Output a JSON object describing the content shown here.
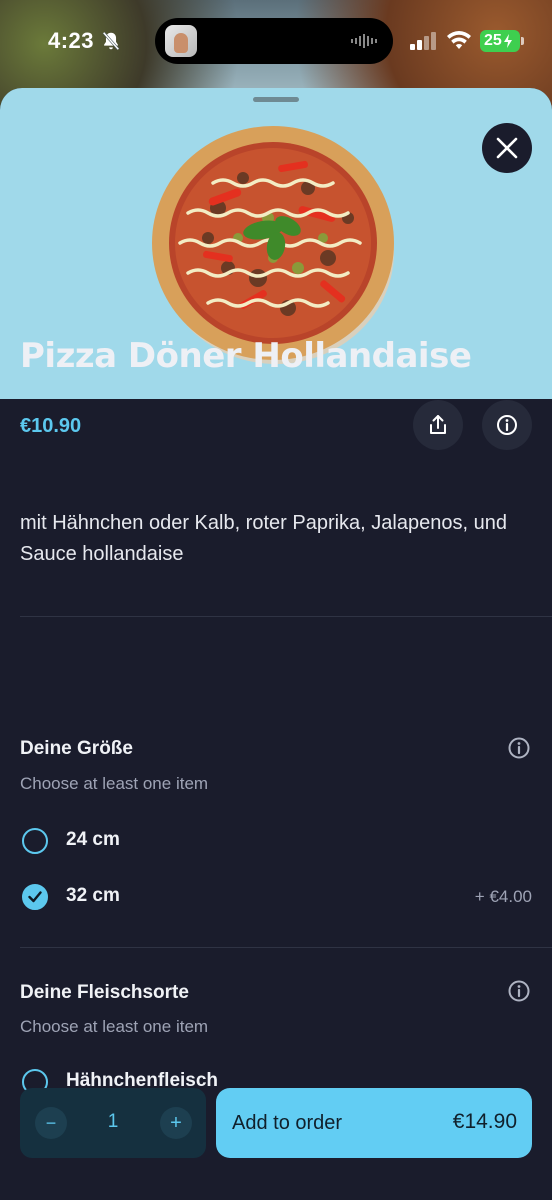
{
  "status_bar": {
    "time": "4:23",
    "battery": "25",
    "icons": [
      "bell-slash-icon",
      "waveform-icon",
      "signal-icon",
      "wifi-icon",
      "battery-charging-icon"
    ]
  },
  "product": {
    "title": "Pizza Döner Hollandaise",
    "price": "€10.90",
    "description": "mit Hähnchen oder Kalb, roter Paprika, Jalapenos, und Sauce hollandaise",
    "image": "pizza-photo"
  },
  "groups": [
    {
      "title": "Deine Größe",
      "subtitle": "Choose at least one item",
      "options": [
        {
          "label": "24 cm",
          "extra": "",
          "selected": false
        },
        {
          "label": "32 cm",
          "extra": "+ €4.00",
          "selected": true
        }
      ]
    },
    {
      "title": "Deine Fleischsorte",
      "subtitle": "Choose at least one item",
      "options": [
        {
          "label": "Hähnchenfleisch",
          "extra": "",
          "selected": false
        }
      ]
    }
  ],
  "order_bar": {
    "quantity": "1",
    "minus": "−",
    "plus": "+",
    "add_label": "Add to order",
    "total": "€14.90"
  },
  "colors": {
    "accent": "#5cc8ee",
    "hero_bg": "#a0d9ea",
    "sheet_bg": "#1a1c2c"
  }
}
